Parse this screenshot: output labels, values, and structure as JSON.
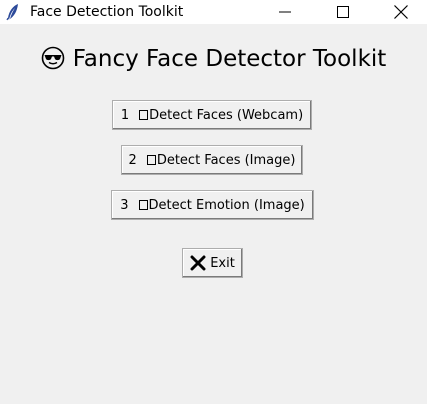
{
  "window": {
    "title": "Face Detection Toolkit",
    "icon": "feather-icon"
  },
  "header": {
    "emoji": "sunglasses-face-icon",
    "title": "Fancy Face Detector Toolkit"
  },
  "buttons": [
    {
      "number": "1",
      "label": "Detect Faces (Webcam)"
    },
    {
      "number": "2",
      "label": "Detect Faces (Image)"
    },
    {
      "number": "3",
      "label": "Detect Emotion (Image)"
    }
  ],
  "exit_button": {
    "icon": "close-x-icon",
    "label": "Exit"
  }
}
